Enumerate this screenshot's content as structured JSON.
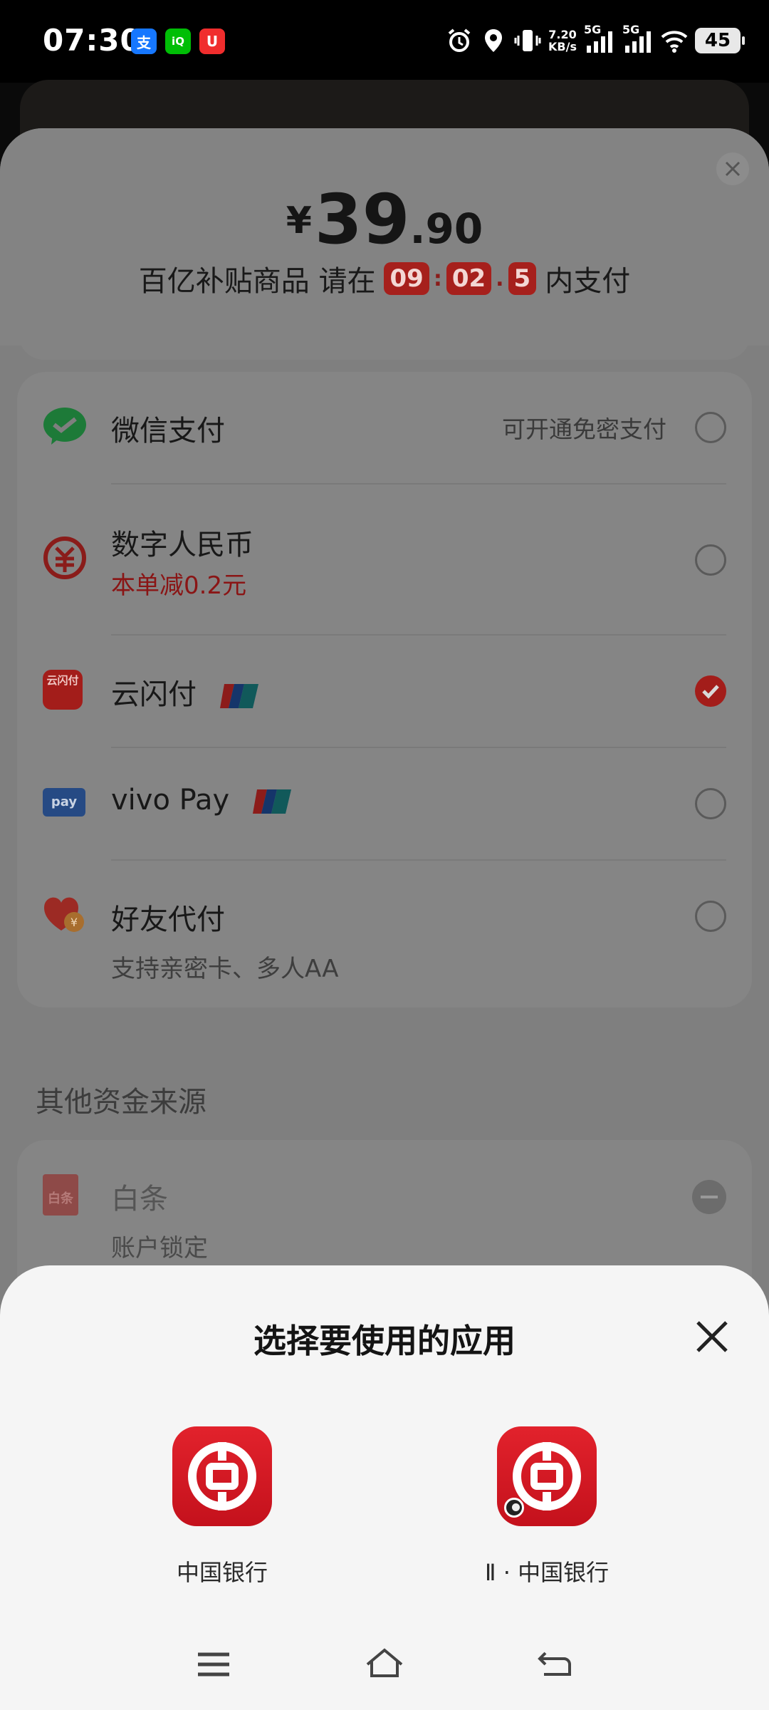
{
  "status_bar": {
    "time": "07:30",
    "apps": [
      {
        "icon": "alipay-icon",
        "glyph": "支",
        "color": "#1677ff"
      },
      {
        "icon": "iqiyi-icon",
        "glyph": "iQ",
        "color": "#00be06"
      },
      {
        "icon": "taobao-special-icon",
        "glyph": "U",
        "color": "#f02d2d"
      }
    ],
    "net_speed_value": "7.20",
    "net_speed_unit": "KB/s",
    "sim1": "5G",
    "sim2": "5G",
    "battery": "45"
  },
  "payment": {
    "currency": "¥",
    "price_integer": "39",
    "price_decimal": ".90",
    "countdown_prefix": "百亿补贴商品 请在",
    "countdown_min": "09",
    "countdown_sec": "02",
    "countdown_tenth": "5",
    "countdown_suffix": "内支付",
    "methods": [
      {
        "name": "微信支付",
        "note": "可开通免密支付",
        "selected": false,
        "icon": "wechat-pay-icon"
      },
      {
        "name": "数字人民币",
        "subtitle": "本单减0.2元",
        "selected": false,
        "icon": "digital-rmb-icon"
      },
      {
        "name": "云闪付",
        "selected": true,
        "icon": "cloud-quickpass-icon",
        "badge": "unionpay-badge-icon"
      },
      {
        "name": "vivo Pay",
        "selected": false,
        "icon": "vivo-pay-icon",
        "badge": "unionpay-badge-icon"
      },
      {
        "name": "好友代付",
        "subtitle": "支持亲密卡、多人AA",
        "selected": false,
        "icon": "friend-pay-icon"
      }
    ],
    "other_sources_title": "其他资金来源",
    "baitiao": {
      "name": "白条",
      "subtitle": "账户锁定",
      "icon": "baitiao-icon"
    }
  },
  "chooser": {
    "title": "选择要使用的应用",
    "apps": [
      {
        "label": "中国银行",
        "icon": "bank-of-china-icon"
      },
      {
        "label": "Ⅱ · 中国银行",
        "icon": "bank-of-china-clone-icon"
      }
    ]
  },
  "colors": {
    "accent_red": "#c4111c",
    "selected_red": "#a31d1a"
  }
}
